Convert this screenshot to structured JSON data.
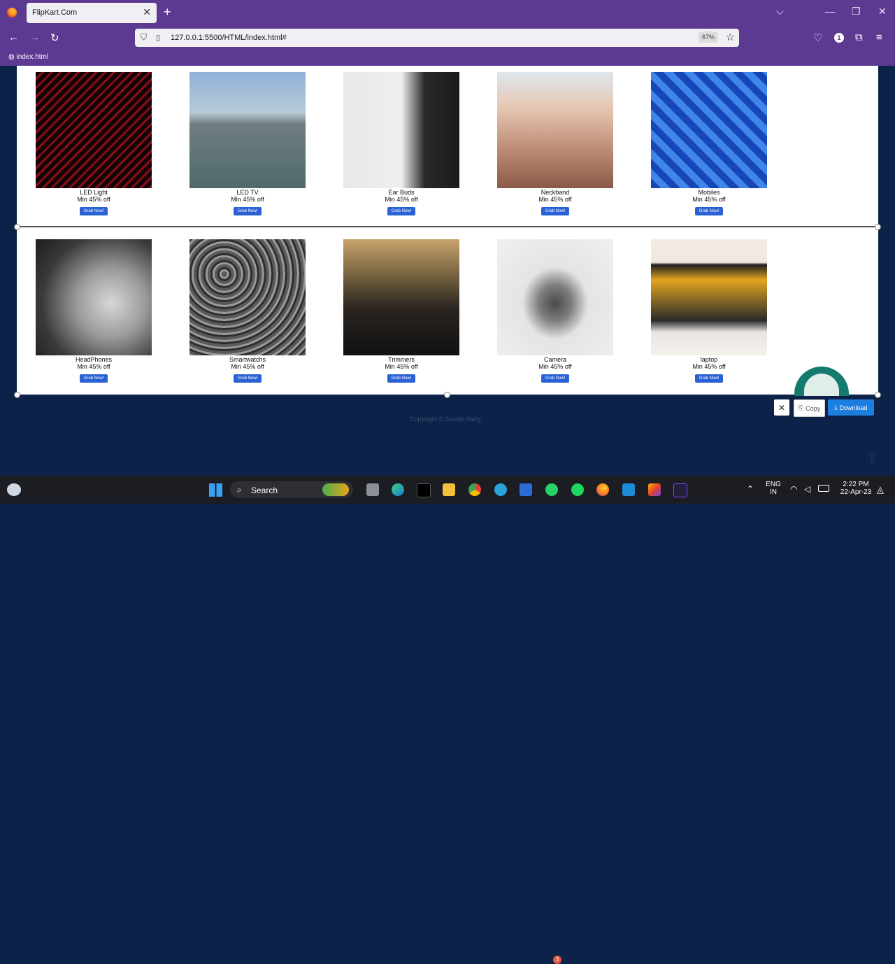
{
  "browser": {
    "tab_title": "FlipKart.Com",
    "url": "127.0.0.1:5500/HTML/index.html#",
    "zoom": "67%",
    "bookmark": "index.html",
    "extension_badge": "1"
  },
  "products_row1": [
    {
      "name": "LED Light",
      "offer": "Min 45% off",
      "button": "Grab Now!"
    },
    {
      "name": "LED TV",
      "offer": "Min 45% off",
      "button": "Grab Now!"
    },
    {
      "name": "Ear Buds",
      "offer": "Min 45% off",
      "button": "Grab Now!"
    },
    {
      "name": "Neckband",
      "offer": "Min 45% off",
      "button": "Grab Now!"
    },
    {
      "name": "Mobiles",
      "offer": "Min 45% off",
      "button": "Grab Now!"
    }
  ],
  "products_row2": [
    {
      "name": "HeadPhones",
      "offer": "Min 45% off",
      "button": "Grab Now!"
    },
    {
      "name": "Smartwatchs",
      "offer": "Min 45% off",
      "button": "Grab Now!"
    },
    {
      "name": "Trimmers",
      "offer": "Min 45% off",
      "button": "Grab Now!"
    },
    {
      "name": "Camera",
      "offer": "Min 45% off",
      "button": "Grab Now!"
    },
    {
      "name": "laptop",
      "offer": "Min 45% off",
      "button": "Grab Now!"
    }
  ],
  "footer": {
    "copyright": "Copyright © Sandip Maity"
  },
  "snip_toolbar": {
    "close": "✕",
    "copy": "Copy",
    "download": "Download"
  },
  "taskbar": {
    "search": "Search",
    "notification_badge": "3",
    "lang_1": "ENG",
    "lang_2": "IN",
    "time": "2:22 PM",
    "date": "22-Apr-23"
  }
}
